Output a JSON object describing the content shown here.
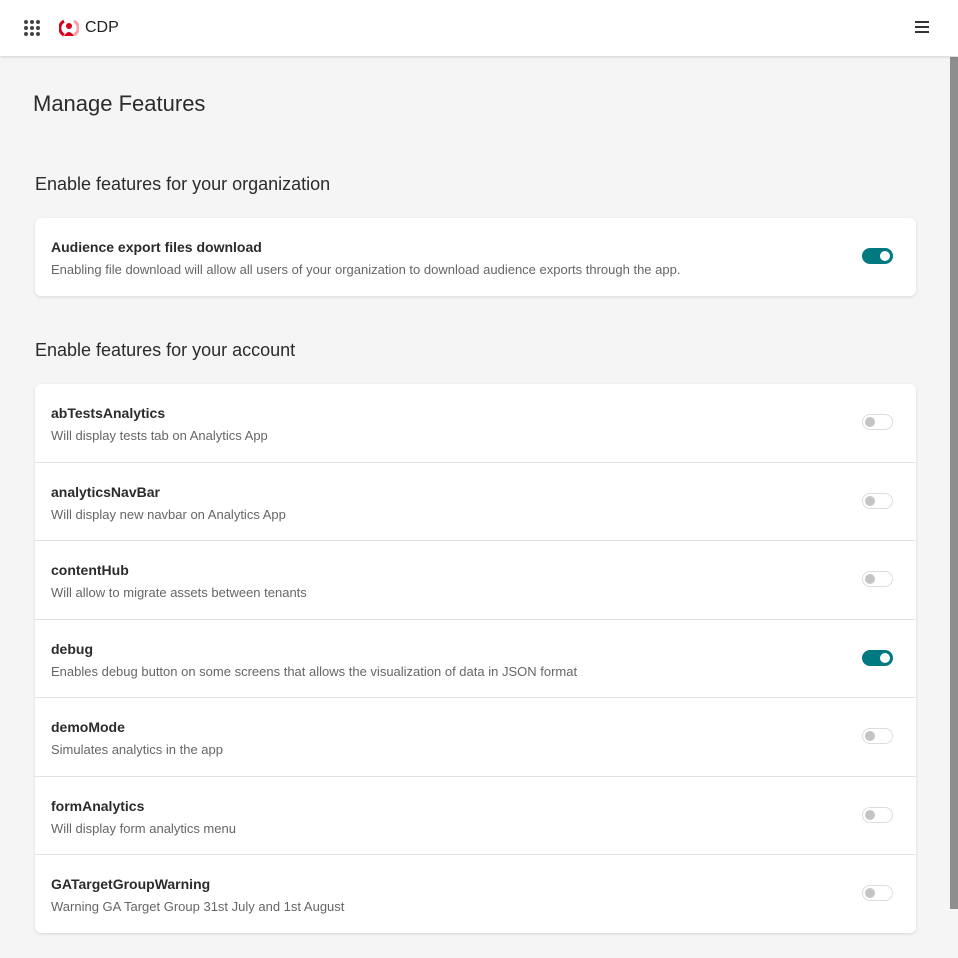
{
  "header": {
    "brand": "CDP",
    "accent": "#d6001c"
  },
  "page_title": "Manage Features",
  "org_section": {
    "heading": "Enable features for your organization",
    "features": [
      {
        "name": "Audience export files download",
        "description": "Enabling file download will allow all users of your organization to download audience exports through the app.",
        "enabled": true
      }
    ]
  },
  "account_section": {
    "heading": "Enable features for your account",
    "features": [
      {
        "name": "abTestsAnalytics",
        "description": "Will display tests tab on Analytics App",
        "enabled": false
      },
      {
        "name": "analyticsNavBar",
        "description": "Will display new navbar on Analytics App",
        "enabled": false
      },
      {
        "name": "contentHub",
        "description": "Will allow to migrate assets between tenants",
        "enabled": false
      },
      {
        "name": "debug",
        "description": "Enables debug button on some screens that allows the visualization of data in JSON format",
        "enabled": true
      },
      {
        "name": "demoMode",
        "description": "Simulates analytics in the app",
        "enabled": false
      },
      {
        "name": "formAnalytics",
        "description": "Will display form analytics menu",
        "enabled": false
      },
      {
        "name": "GATargetGroupWarning",
        "description": "Warning GA Target Group 31st July and 1st August",
        "enabled": false
      }
    ]
  },
  "toggle_on_color": "#007a80"
}
